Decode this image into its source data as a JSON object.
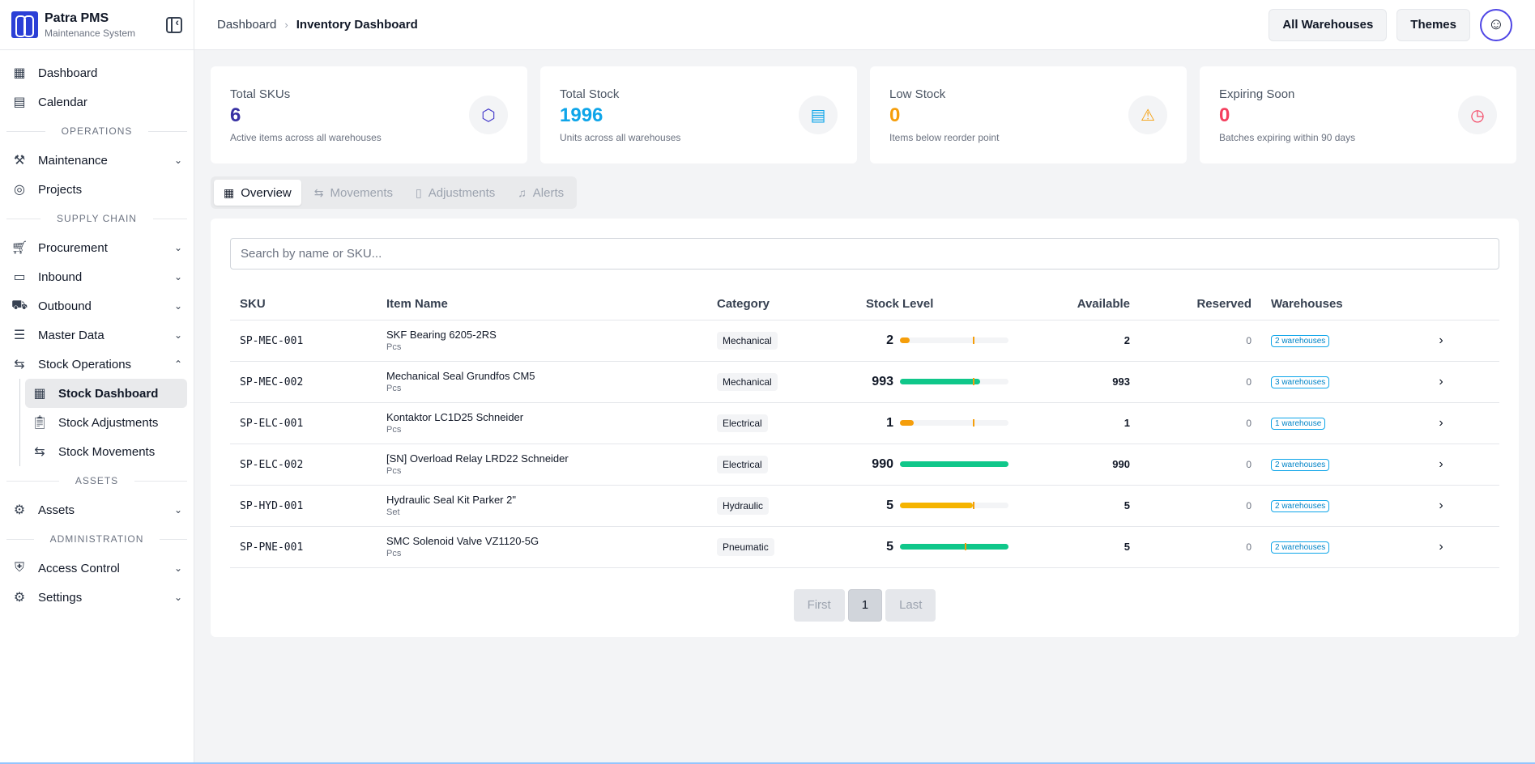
{
  "brand": {
    "title": "Patra PMS",
    "subtitle": "Maintenance System"
  },
  "sidebar": {
    "top_items": [
      {
        "label": "Dashboard",
        "icon": "dashboard-icon"
      },
      {
        "label": "Calendar",
        "icon": "calendar-icon"
      }
    ],
    "sections": {
      "operations": "OPERATIONS",
      "supply_chain": "SUPPLY CHAIN",
      "assets": "ASSETS",
      "administration": "ADMINISTRATION"
    },
    "operations_items": [
      {
        "label": "Maintenance",
        "icon": "wrench-icon"
      },
      {
        "label": "Projects",
        "icon": "target-icon"
      }
    ],
    "supply_items": [
      {
        "label": "Procurement",
        "icon": "cart-icon"
      },
      {
        "label": "Inbound",
        "icon": "box-icon"
      },
      {
        "label": "Outbound",
        "icon": "truck-icon"
      },
      {
        "label": "Master Data",
        "icon": "database-icon"
      },
      {
        "label": "Stock Operations",
        "icon": "arrows-icon"
      }
    ],
    "stock_sub_items": [
      {
        "label": "Stock Dashboard",
        "icon": "grid-icon",
        "active": true
      },
      {
        "label": "Stock Adjustments",
        "icon": "clipboard-icon"
      },
      {
        "label": "Stock Movements",
        "icon": "arrows-icon"
      }
    ],
    "assets_items": [
      {
        "label": "Assets",
        "icon": "robot-icon"
      }
    ],
    "admin_items": [
      {
        "label": "Access Control",
        "icon": "shield-icon"
      },
      {
        "label": "Settings",
        "icon": "gear-icon"
      }
    ]
  },
  "header": {
    "breadcrumb_root": "Dashboard",
    "breadcrumb_current": "Inventory Dashboard",
    "warehouse_button": "All Warehouses",
    "themes_button": "Themes"
  },
  "stats": [
    {
      "label": "Total SKUs",
      "value": "6",
      "desc": "Active items across all warehouses",
      "color": "#3730a3",
      "icon": "cube-icon"
    },
    {
      "label": "Total Stock",
      "value": "1996",
      "desc": "Units across all warehouses",
      "color": "#0ea5e9",
      "icon": "warehouse-icon"
    },
    {
      "label": "Low Stock",
      "value": "0",
      "desc": "Items below reorder point",
      "color": "#f59e0b",
      "icon": "warning-icon"
    },
    {
      "label": "Expiring Soon",
      "value": "0",
      "desc": "Batches expiring within 90 days",
      "color": "#f43f5e",
      "icon": "clock-icon"
    }
  ],
  "tabs": [
    {
      "label": "Overview",
      "icon": "grid-icon",
      "active": true
    },
    {
      "label": "Movements",
      "icon": "arrows-icon"
    },
    {
      "label": "Adjustments",
      "icon": "clipboard-icon"
    },
    {
      "label": "Alerts",
      "icon": "bell-icon"
    }
  ],
  "search": {
    "placeholder": "Search by name or SKU..."
  },
  "table": {
    "headers": [
      "SKU",
      "Item Name",
      "Category",
      "Stock Level",
      "Available",
      "Reserved",
      "Warehouses"
    ],
    "rows": [
      {
        "sku": "SP-MEC-001",
        "name": "SKF Bearing 6205-2RS",
        "unit": "Pcs",
        "category": "Mechanical",
        "stock": "2",
        "available": "2",
        "reserved": "0",
        "warehouses": "2 warehouses",
        "level": 0.09,
        "mark": 0.67,
        "color": "#f59e0b"
      },
      {
        "sku": "SP-MEC-002",
        "name": "Mechanical Seal Grundfos CM5",
        "unit": "Pcs",
        "category": "Mechanical",
        "stock": "993",
        "available": "993",
        "reserved": "0",
        "warehouses": "3 warehouses",
        "level": 0.74,
        "mark": 0.67,
        "color": "#10c78a"
      },
      {
        "sku": "SP-ELC-001",
        "name": "Kontaktor LC1D25 Schneider",
        "unit": "Pcs",
        "category": "Electrical",
        "stock": "1",
        "available": "1",
        "reserved": "0",
        "warehouses": "1 warehouse",
        "level": 0.13,
        "mark": 0.67,
        "color": "#f59e0b"
      },
      {
        "sku": "SP-ELC-002",
        "name": "[SN] Overload Relay LRD22 Schneider",
        "unit": "Pcs",
        "category": "Electrical",
        "stock": "990",
        "available": "990",
        "reserved": "0",
        "warehouses": "2 warehouses",
        "level": 1.0,
        "mark": 0.0,
        "color": "#10c78a"
      },
      {
        "sku": "SP-HYD-001",
        "name": "Hydraulic Seal Kit Parker 2\"",
        "unit": "Set",
        "category": "Hydraulic",
        "stock": "5",
        "available": "5",
        "reserved": "0",
        "warehouses": "2 warehouses",
        "level": 0.67,
        "mark": 0.67,
        "color": "#f5b400"
      },
      {
        "sku": "SP-PNE-001",
        "name": "SMC Solenoid Valve VZ1120-5G",
        "unit": "Pcs",
        "category": "Pneumatic",
        "stock": "5",
        "available": "5",
        "reserved": "0",
        "warehouses": "2 warehouses",
        "level": 1.0,
        "mark": 0.6,
        "color": "#10c78a"
      }
    ]
  },
  "pagination": {
    "first": "First",
    "current": "1",
    "last": "Last"
  }
}
